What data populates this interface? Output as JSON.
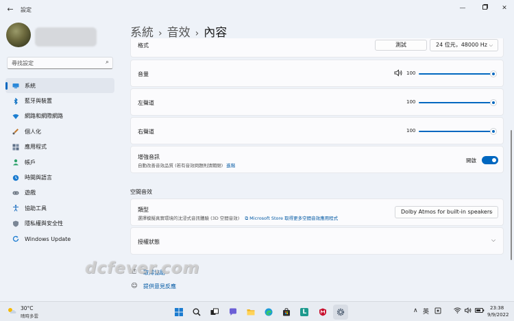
{
  "window": {
    "title": "設定",
    "controls": [
      "minimize",
      "maximize",
      "close"
    ]
  },
  "search": {
    "placeholder": "尋找設定"
  },
  "sidebar": {
    "items": [
      {
        "label": "系統",
        "icon": "system-icon",
        "active": true
      },
      {
        "label": "藍牙與裝置",
        "icon": "bluetooth-icon"
      },
      {
        "label": "網路和網際網路",
        "icon": "network-icon"
      },
      {
        "label": "個人化",
        "icon": "personalization-icon"
      },
      {
        "label": "應用程式",
        "icon": "apps-icon"
      },
      {
        "label": "帳戶",
        "icon": "accounts-icon"
      },
      {
        "label": "時間與語言",
        "icon": "time-language-icon"
      },
      {
        "label": "遊戲",
        "icon": "gaming-icon"
      },
      {
        "label": "協助工具",
        "icon": "accessibility-icon"
      },
      {
        "label": "隱私權與安全性",
        "icon": "privacy-icon"
      },
      {
        "label": "Windows Update",
        "icon": "windows-update-icon"
      }
    ]
  },
  "breadcrumb": {
    "parts": [
      "系統",
      "音效",
      "內容"
    ],
    "separator": "›"
  },
  "format": {
    "label": "格式",
    "test_button": "測試",
    "format_value": "24 位元，48000 Hz"
  },
  "volume": {
    "label": "音量",
    "value": "100"
  },
  "left_channel": {
    "label": "左聲道",
    "value": "100"
  },
  "right_channel": {
    "label": "右聲道",
    "value": "100"
  },
  "enhance": {
    "label": "增強音訊",
    "description": "自動改善音效品質 (若有音效問題則請關閉)",
    "link": "進階",
    "state_label": "開啟",
    "on": true
  },
  "spatial": {
    "section_title": "空間音效",
    "type_label": "類型",
    "type_description": "選擇模擬真實環境的沈浸式音訊體驗 (3D 空間音效)",
    "store_link": "Microsoft Store 取得更多空間音效應用程式",
    "type_value": "Dolby Atmos for built-in speakers",
    "license_label": "授權狀態"
  },
  "footer": {
    "help": "取得協助",
    "feedback": "提供意見反應"
  },
  "watermark": "dcfever.com",
  "taskbar": {
    "weather_temp": "30°C",
    "weather_desc": "晴時多雲",
    "ime": "英",
    "time": "23:38",
    "date": "9/9/2022",
    "apps": [
      "start-icon",
      "search-icon",
      "task-view-icon",
      "chat-icon",
      "file-explorer-icon",
      "edge-icon",
      "store-icon",
      "l-app-icon",
      "mcafee-icon",
      "settings-icon"
    ]
  },
  "colors": {
    "accent": "#0067c0",
    "link": "#0058a3",
    "background": "#eef2f8",
    "card": "#fbfbfd"
  }
}
